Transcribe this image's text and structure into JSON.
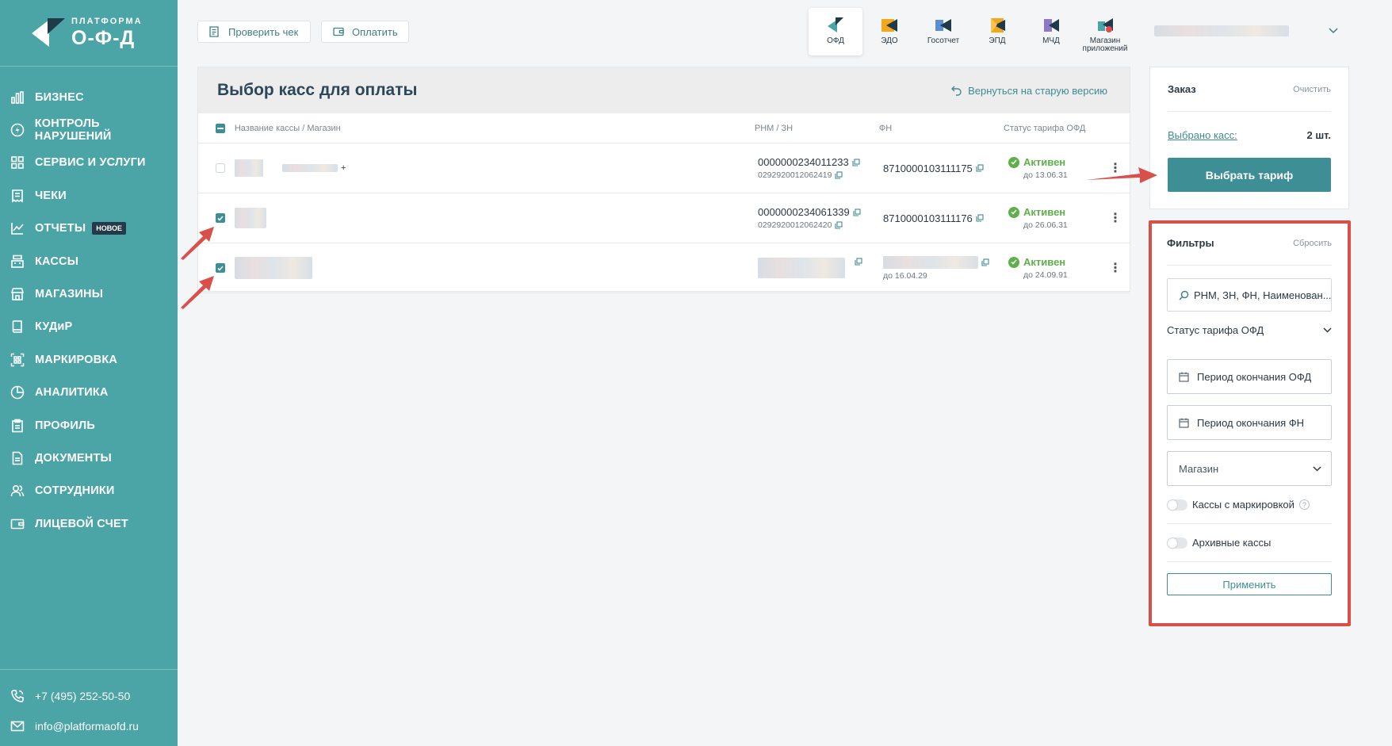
{
  "brand": {
    "top": "ПЛАТФОРМА",
    "bottom": "О-Ф-Д"
  },
  "sidebar": {
    "items": [
      {
        "label": "БИЗНЕС",
        "icon": "bar-chart-icon"
      },
      {
        "label": "КОНТРОЛЬ НАРУШЕНИЙ",
        "icon": "lightning-icon"
      },
      {
        "label": "СЕРВИС И УСЛУГИ",
        "icon": "grid-icon"
      },
      {
        "label": "ЧЕКИ",
        "icon": "receipt-icon"
      },
      {
        "label": "ОТЧЕТЫ",
        "icon": "line-chart-icon",
        "badge": "НОВОЕ"
      },
      {
        "label": "КАССЫ",
        "icon": "register-icon"
      },
      {
        "label": "МАГАЗИНЫ",
        "icon": "store-icon"
      },
      {
        "label": "КУДиР",
        "icon": "book-icon"
      },
      {
        "label": "МАРКИРОВКА",
        "icon": "qr-icon"
      },
      {
        "label": "АНАЛИТИКА",
        "icon": "pie-icon"
      },
      {
        "label": "ПРОФИЛЬ",
        "icon": "clipboard-icon"
      },
      {
        "label": "ДОКУМЕНТЫ",
        "icon": "document-icon"
      },
      {
        "label": "СОТРУДНИКИ",
        "icon": "users-icon"
      },
      {
        "label": "ЛИЦЕВОЙ СЧЕТ",
        "icon": "wallet-icon"
      }
    ],
    "phone": "+7 (495) 252-50-50",
    "email": "info@platformaofd.ru"
  },
  "topbar": {
    "check_label": "Проверить чек",
    "pay_label": "Оплатить",
    "apps": [
      {
        "label": "ОФД",
        "active": true
      },
      {
        "label": "ЭДО"
      },
      {
        "label": "Госотчет"
      },
      {
        "label": "ЭПД"
      },
      {
        "label": "МЧД"
      },
      {
        "label": "Магазин приложений"
      }
    ]
  },
  "main": {
    "title": "Выбор касс для оплаты",
    "back_link": "Вернуться на старую версию",
    "columns": [
      "Название кассы / Магазин",
      "РНМ / ЗН",
      "ФН",
      "Статус тарифа ОФД"
    ],
    "rows": [
      {
        "checked": false,
        "rnm": "0000000234011233",
        "zn": "0292920012062419",
        "fn": "8710000103111175",
        "fn_sub": "",
        "status": "Активен",
        "status_until": "до 13.06.31"
      },
      {
        "checked": true,
        "rnm": "0000000234061339",
        "zn": "0292920012062420",
        "fn": "8710000103111176",
        "fn_sub": "",
        "status": "Активен",
        "status_until": "до 26.06.31"
      },
      {
        "checked": true,
        "rnm": "",
        "zn": "",
        "fn": "",
        "fn_sub": "до 16.04.29",
        "status": "Активен",
        "status_until": "до 24.09.91"
      }
    ]
  },
  "order": {
    "title": "Заказ",
    "clear": "Очистить",
    "selected_label": "Выбрано касс:",
    "selected_count": "2 шт.",
    "choose_button": "Выбрать тариф"
  },
  "filters": {
    "title": "Фильтры",
    "reset": "Сбросить",
    "search_placeholder": "РНМ, ЗН, ФН, Наименован...",
    "status_select": "Статус тарифа ОФД",
    "period_ofd": "Период окончания ОФД",
    "period_fn": "Период окончания ФН",
    "shop_select": "Магазин",
    "toggle_marking": "Кассы с маркировкой",
    "toggle_archive": "Архивные кассы",
    "apply": "Применить"
  },
  "colors": {
    "teal": "#4ba4a6",
    "button": "#3d8f95",
    "active": "#5fb04b",
    "annotation": "#d9504a"
  }
}
